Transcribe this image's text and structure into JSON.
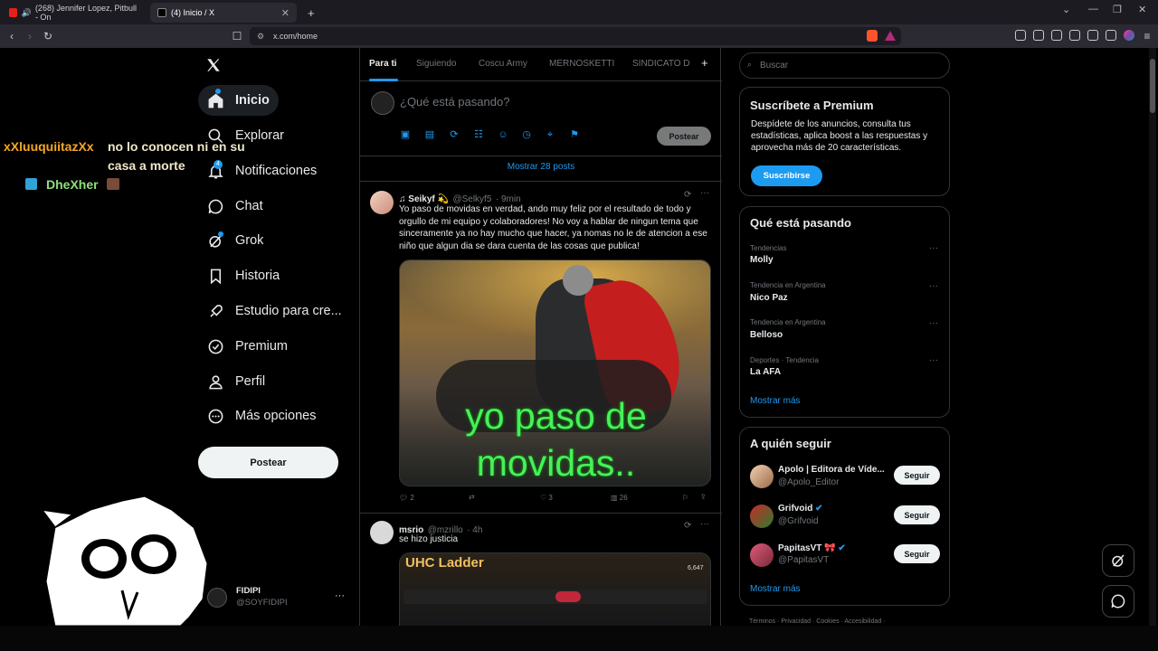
{
  "browser": {
    "tabs": [
      {
        "label": "(268) Jennifer Lopez, Pitbull - On"
      },
      {
        "label": "(4) Inicio / X"
      }
    ],
    "new_tab": "+",
    "url": "x.com/home"
  },
  "overlay": {
    "user1": "xXluuquiitazXx",
    "message": "no lo conocen ni en su",
    "message2": "casa a morte",
    "user2": "DheXher"
  },
  "nav": {
    "items": [
      {
        "label": "Inicio",
        "icon": "home-icon"
      },
      {
        "label": "Explorar",
        "icon": "search-icon"
      },
      {
        "label": "Notificaciones",
        "icon": "bell-icon",
        "badge": "4"
      },
      {
        "label": "Chat",
        "icon": "chat-icon"
      },
      {
        "label": "Grok",
        "icon": "grok-icon"
      },
      {
        "label": "Historia",
        "icon": "bookmark-icon"
      },
      {
        "label": "Estudio para cre...",
        "icon": "rocket-icon"
      },
      {
        "label": "Premium",
        "icon": "verified-icon"
      },
      {
        "label": "Perfil",
        "icon": "person-icon"
      },
      {
        "label": "Más opciones",
        "icon": "more-circle-icon"
      }
    ],
    "post_button": "Postear",
    "account": {
      "name": "FIDIPI",
      "handle": "@SOYFIDIPI",
      "more": "···"
    }
  },
  "feed": {
    "tabs": [
      "Para ti",
      "Siguiendo",
      "Coscu Army",
      "MERNOSKETTI",
      "SINDICATO D"
    ],
    "add_tab": "+",
    "composer_placeholder": "¿Qué está pasando?",
    "composer_post": "Postear",
    "show_more": "Mostrar 28 posts",
    "posts": [
      {
        "name": "♫ Seikyf 💫",
        "handle": "@Selkyf5",
        "time": "· 9min",
        "text": "Yo paso de movidas en verdad, ando muy feliz por el resultado de todo y orgullo de mi equipo y colaboradores! No voy a hablar de ningun tema que sinceramente ya no hay mucho que hacer, ya nomas no le de atencion a ese niño que algun dia se dara cuenta de las cosas que publica!",
        "image_caption": "yo paso de movidas..",
        "replies": "2",
        "retweets": "",
        "likes": "3",
        "views": "26"
      },
      {
        "name": "msrio",
        "handle": "@mzrillo",
        "time": "· 4h",
        "text": "se hizo justicia",
        "image_title": "UHC Ladder",
        "image_sub": "6,647"
      }
    ]
  },
  "sidebar": {
    "search_placeholder": "Buscar",
    "premium": {
      "title": "Suscríbete a Premium",
      "text": "Despídete de los anuncios, consulta tus estadísticas, aplica boost a las respuestas y aprovecha más de 20 características.",
      "button": "Suscribirse"
    },
    "trends": {
      "title": "Qué está pasando",
      "items": [
        {
          "meta": "Tendencias",
          "name": "Molly"
        },
        {
          "meta": "Tendencia en Argentina",
          "name": "Nico Paz"
        },
        {
          "meta": "Tendencia en Argentina",
          "name": "Belloso"
        },
        {
          "meta": "Deportes · Tendencia",
          "name": "La AFA"
        }
      ],
      "more": "Mostrar más"
    },
    "follow": {
      "title": "A quién seguir",
      "items": [
        {
          "name": "Apolo | Editora de Víde...",
          "handle": "@Apolo_Editor",
          "button": "Seguir"
        },
        {
          "name": "Grifvoid",
          "handle": "@Grifvoid",
          "button": "Seguir"
        },
        {
          "name": "PapitasVT 🎀",
          "handle": "@PapitasVT",
          "button": "Seguir"
        }
      ],
      "more": "Mostrar más"
    },
    "footer": "Términos · Privacidad · Cookies · Accesibilidad ·"
  }
}
